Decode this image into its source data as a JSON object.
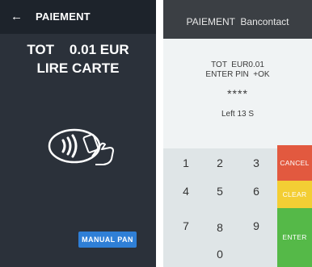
{
  "left": {
    "back_icon": "←",
    "title": "PAIEMENT",
    "total_line": "TOT    0.01 EUR",
    "instruction": "LIRE CARTE",
    "manual_pan_label": "MANUAL PAN",
    "contactless_icon": "contactless-card-hand-icon"
  },
  "right": {
    "title": "PAIEMENT  Bancontact",
    "total_line": "TOT  EUR0.01",
    "pin_prompt": "ENTER PIN  +OK",
    "pin_masked": "****",
    "time_left": "Left 13 S",
    "keys": [
      {
        "label": "1"
      },
      {
        "label": "2"
      },
      {
        "label": "3"
      },
      {
        "label": "4"
      },
      {
        "label": "5"
      },
      {
        "label": "6"
      },
      {
        "label": "7"
      },
      {
        "label": "8"
      },
      {
        "label": "9"
      },
      {
        "label": "0"
      }
    ],
    "cancel_label": "CANCEL",
    "clear_label": "CLEAR",
    "enter_label": "ENTER",
    "colors": {
      "cancel": "#e2593f",
      "clear": "#f3ce34",
      "enter": "#55b948"
    }
  }
}
